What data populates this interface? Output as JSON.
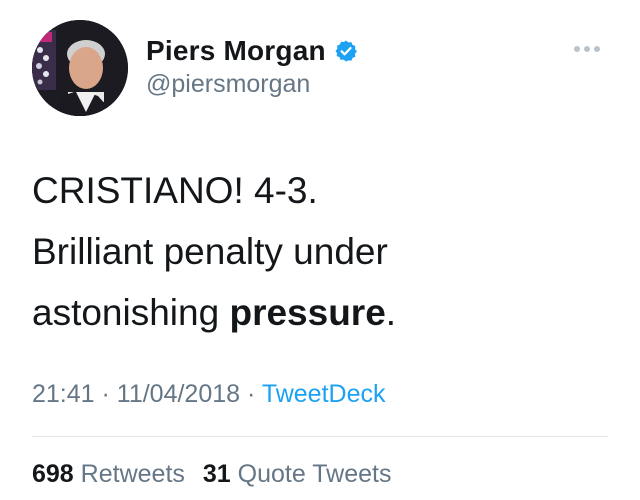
{
  "author": {
    "display_name": "Piers Morgan",
    "handle": "@piersmorgan",
    "verified": true,
    "avatar_icon": "profile-photo",
    "verified_icon": "verified-badge-icon"
  },
  "tweet": {
    "line1": "CRISTIANO! 4-3.",
    "line2": "Brilliant penalty under",
    "line3_prefix": "astonishing ",
    "line3_bold": "pressure",
    "line3_suffix": "."
  },
  "meta": {
    "time": "21:41",
    "separator1": " · ",
    "date": "11/04/2018",
    "separator2": " · ",
    "source": "TweetDeck"
  },
  "stats": {
    "retweets_count": "698",
    "retweets_label": "Retweets",
    "quotes_count": "31",
    "quotes_label": "Quote Tweets"
  },
  "colors": {
    "text": "#14171a",
    "secondary": "#657786",
    "link": "#1da1f2",
    "divider": "#e1e8ed"
  }
}
